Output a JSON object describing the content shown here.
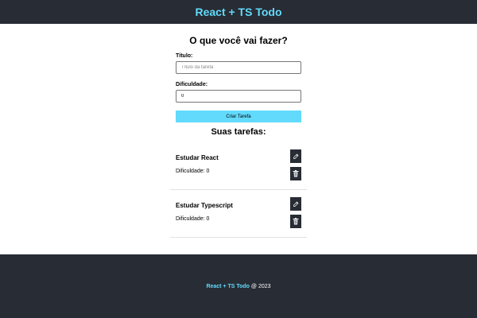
{
  "header": {
    "title": "React + TS Todo"
  },
  "form": {
    "heading": "O que você vai fazer?",
    "title_label": "Título:",
    "title_placeholder": "Título da tarefa",
    "title_value": "",
    "difficulty_label": "Dificuldade:",
    "difficulty_value": "0",
    "submit_label": "Criar Tarefa"
  },
  "list": {
    "heading": "Suas tarefas:",
    "tasks": [
      {
        "name": "Estudar React",
        "difficulty": "Dificuldade: 0",
        "edit_icon": "pencil-icon",
        "delete_icon": "trash-icon"
      },
      {
        "name": "Estudar Typescript",
        "difficulty": "Dificuldade: 0",
        "edit_icon": "pencil-icon",
        "delete_icon": "trash-icon"
      }
    ]
  },
  "footer": {
    "brand": "React + TS Todo",
    "suffix": " @ 2023"
  },
  "colors": {
    "dark": "#282c34",
    "accent": "#61dafb",
    "background": "#ffffff"
  }
}
